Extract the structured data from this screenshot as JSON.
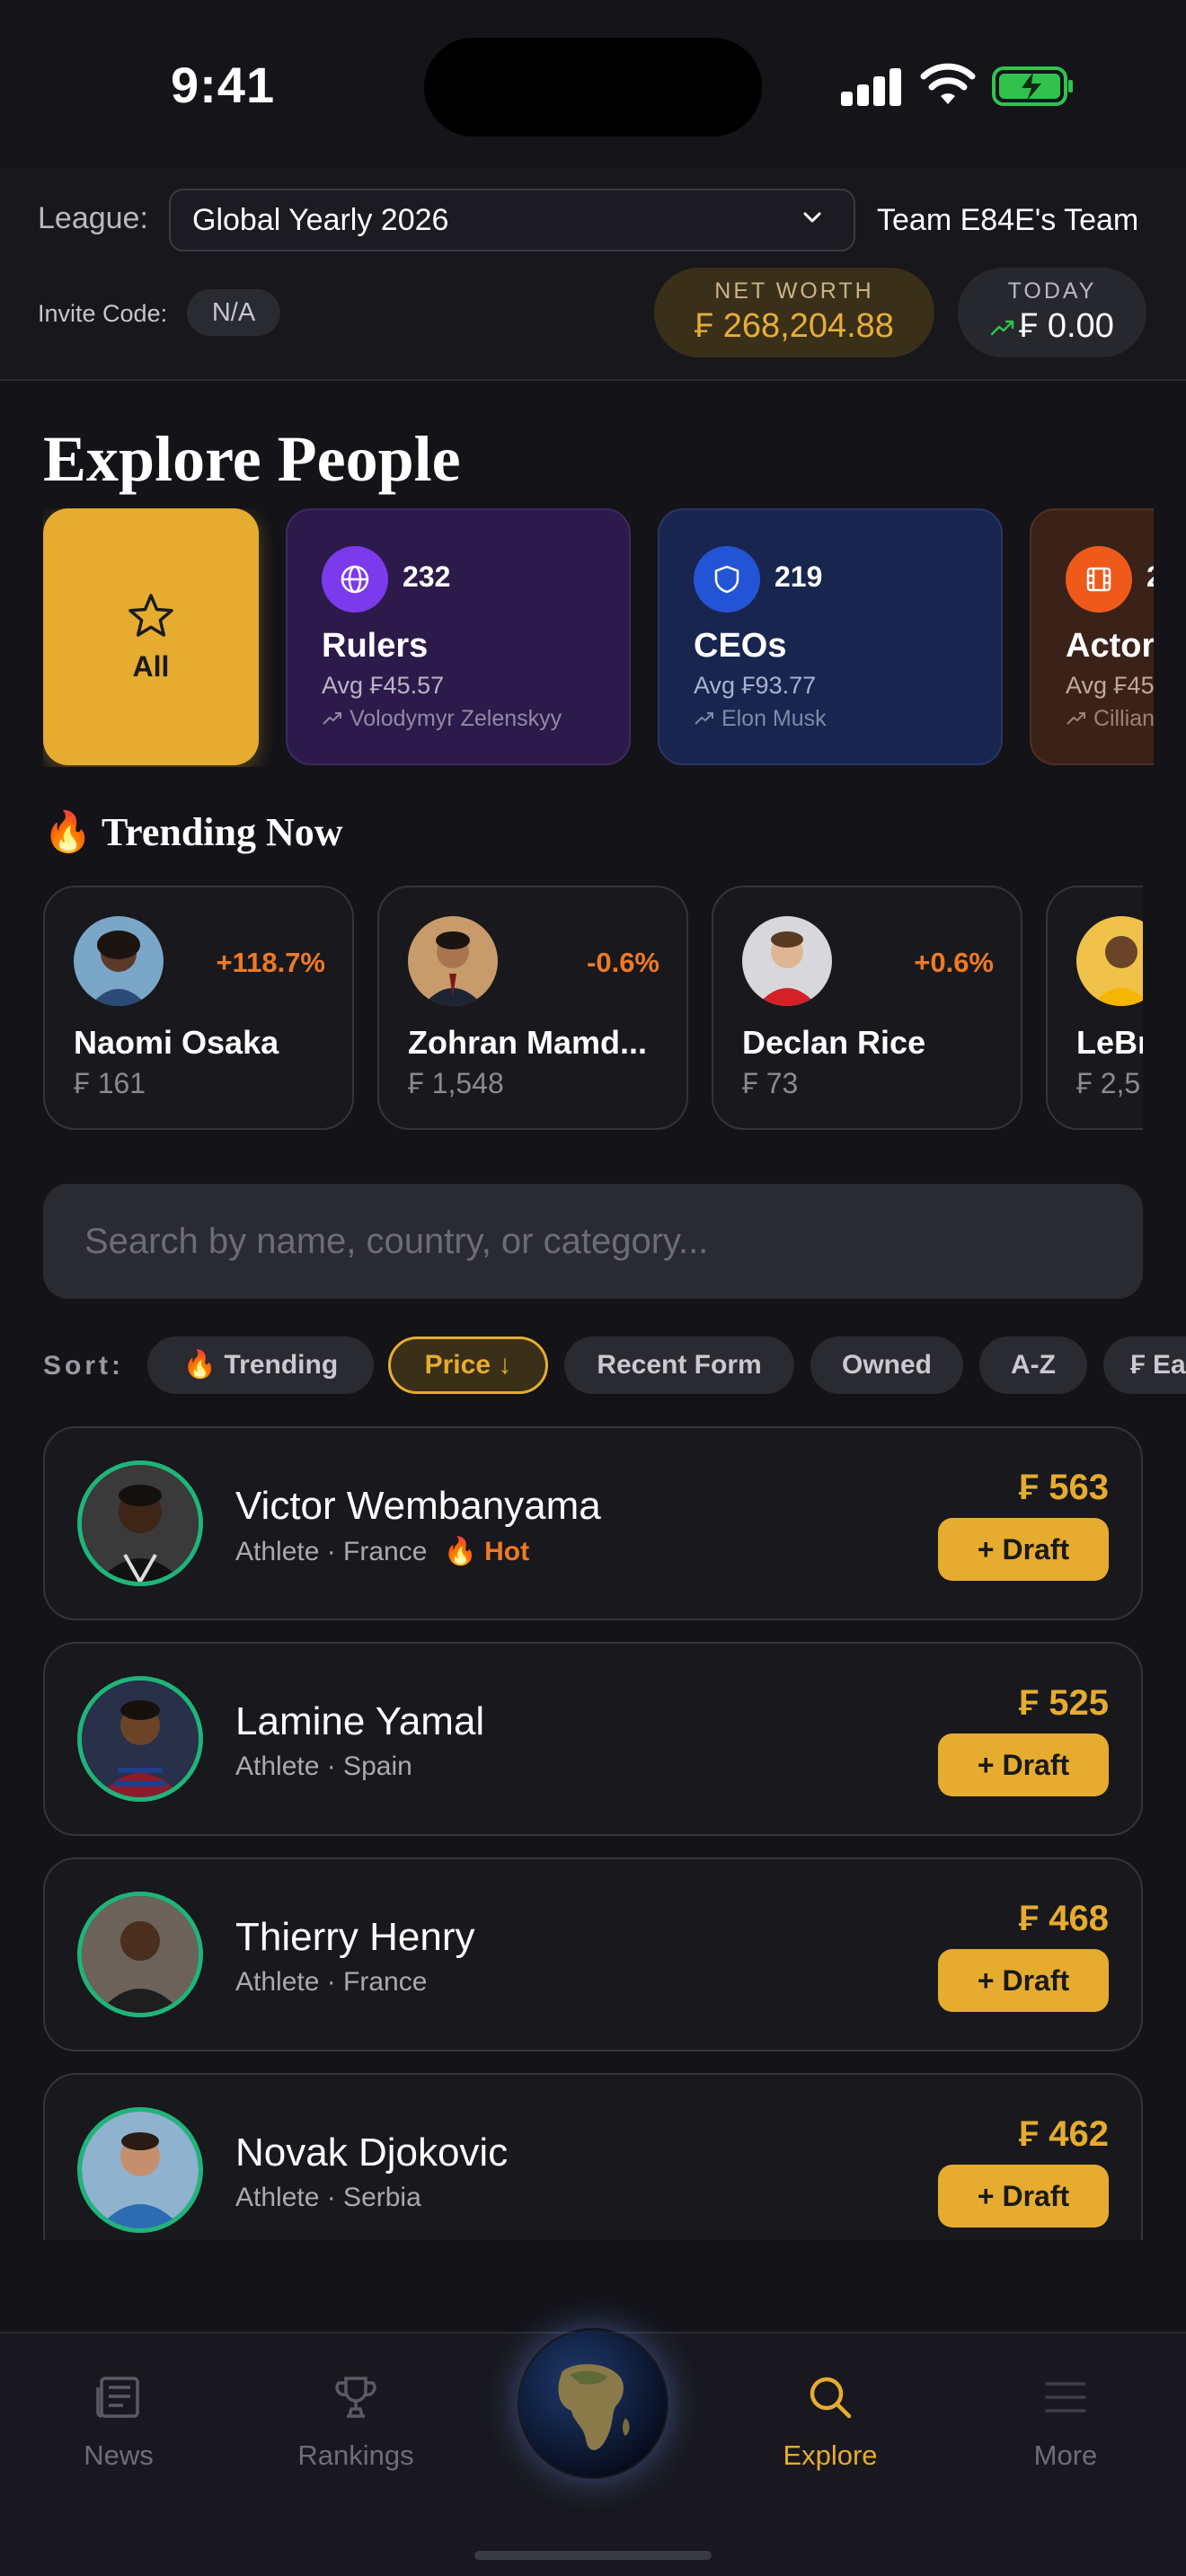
{
  "status_bar": {
    "time": "9:41"
  },
  "header": {
    "league_label": "League:",
    "league_value": "Global Yearly 2026",
    "team_name": "Team E84E's Team",
    "invite_label": "Invite Code:",
    "invite_value": "N/A",
    "net_worth_label": "NET WORTH",
    "net_worth_value": "₣ 268,204.88",
    "today_label": "TODAY",
    "today_value": "₣ 0.00"
  },
  "explore": {
    "title": "Explore People"
  },
  "categories": [
    {
      "label": "All"
    },
    {
      "count": "232",
      "name": "Rulers",
      "avg": "Avg ₣45.57",
      "top": "Volodymyr Zelenskyy",
      "icon": "globe-icon"
    },
    {
      "count": "219",
      "name": "CEOs",
      "avg": "Avg ₣93.77",
      "top": "Elon Musk",
      "icon": "shield-icon"
    },
    {
      "count": "2",
      "name": "Actors",
      "avg": "Avg ₣45",
      "top": "Cillian",
      "icon": "film-icon"
    }
  ],
  "trending": {
    "title": "Trending Now",
    "items": [
      {
        "name": "Naomi Osaka",
        "change": "+118.7%",
        "price": "₣ 161"
      },
      {
        "name": "Zohran Mamd...",
        "change": "-0.6%",
        "price": "₣ 1,548"
      },
      {
        "name": "Declan Rice",
        "change": "+0.6%",
        "price": "₣ 73"
      },
      {
        "name": "LeBr",
        "change": "",
        "price": "₣ 2,5"
      }
    ]
  },
  "search": {
    "placeholder": "Search by name, country, or category..."
  },
  "sort": {
    "label": "Sort:",
    "options": [
      "🔥 Trending",
      "Price ↓",
      "Recent Form",
      "Owned",
      "A-Z",
      "₣ Ea"
    ],
    "active": "Price ↓"
  },
  "players": [
    {
      "name": "Victor Wembanyama",
      "meta": "Athlete · France",
      "badge": "🔥 Hot",
      "price": "₣ 563",
      "action": "+ Draft"
    },
    {
      "name": "Lamine Yamal",
      "meta": "Athlete · Spain",
      "badge": "",
      "price": "₣ 525",
      "action": "+ Draft"
    },
    {
      "name": "Thierry Henry",
      "meta": "Athlete · France",
      "badge": "",
      "price": "₣ 468",
      "action": "+ Draft"
    },
    {
      "name": "Novak Djokovic",
      "meta": "Athlete · Serbia",
      "badge": "",
      "price": "₣ 462",
      "action": "+ Draft"
    }
  ],
  "nav": {
    "items": [
      {
        "label": "News",
        "icon": "newspaper-icon"
      },
      {
        "label": "Rankings",
        "icon": "trophy-icon"
      },
      {
        "label": "",
        "icon": "globe-icon"
      },
      {
        "label": "Explore",
        "icon": "search-icon"
      },
      {
        "label": "More",
        "icon": "menu-icon"
      }
    ],
    "active": "Explore"
  },
  "colors": {
    "accent": "#e6ac2f",
    "positive": "#1fb57a",
    "trend": "#ee7a24",
    "background": "#131318"
  }
}
